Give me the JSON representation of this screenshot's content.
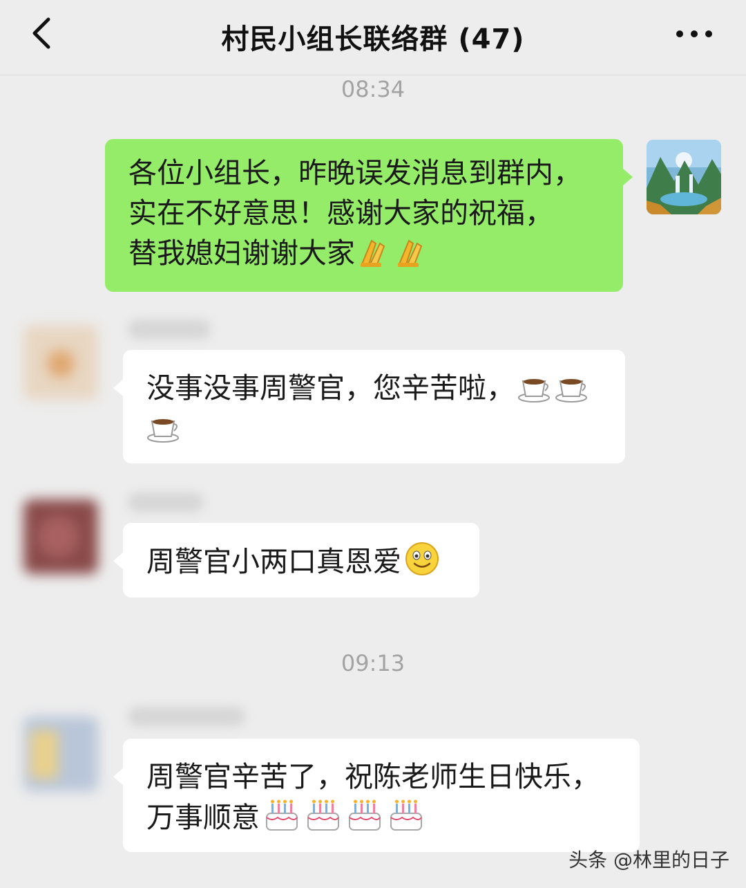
{
  "header": {
    "title": "村民小组长联络群 (47)",
    "back_icon": "chevron-left-icon",
    "more_icon": "more-dots-icon"
  },
  "times": [
    "08:34",
    "09:13"
  ],
  "messages": [
    {
      "side": "right",
      "lines": [
        "各位小组长，昨晚误发消息到群内，",
        "实在不好意思！感谢大家的祝福，",
        "替我媳妇谢谢大家"
      ],
      "emoji": [
        "folded-hands-icon",
        "folded-hands-icon"
      ]
    },
    {
      "side": "left",
      "lines": [
        "没事没事周警官，您辛苦啦，"
      ],
      "emoji": [
        "coffee-cup-icon",
        "coffee-cup-icon",
        "coffee-cup-icon"
      ]
    },
    {
      "side": "left",
      "lines": [
        "周警官小两口真恩爱"
      ],
      "emoji": [
        "smiley-face-icon"
      ]
    },
    {
      "side": "left",
      "lines": [
        "周警官辛苦了，祝陈老师生日快乐，",
        "万事顺意"
      ],
      "emoji": [
        "birthday-cake-icon",
        "birthday-cake-icon",
        "birthday-cake-icon",
        "birthday-cake-icon"
      ]
    }
  ],
  "watermark": "头条 @林里的日子",
  "colors": {
    "background": "#ededed",
    "own_bubble": "#95ec69",
    "other_bubble": "#ffffff",
    "timestamp": "#a3a3a3"
  }
}
